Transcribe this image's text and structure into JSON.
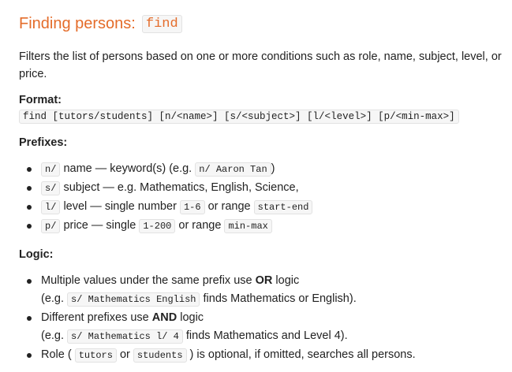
{
  "heading": {
    "text": "Finding persons:",
    "command": "find"
  },
  "description": "Filters the list of persons based on one or more conditions such as role, name, subject, level, or price.",
  "format": {
    "label": "Format:",
    "code": "find [tutors/students] [n/<name>] [s/<subject>] [l/<level>] [p/<min-max>]"
  },
  "prefixes": {
    "label": "Prefixes:",
    "items": [
      {
        "prefix": "n/",
        "text": "name — keyword(s) (e.g.",
        "code1": "n/ Aaron Tan",
        "tail": ")"
      },
      {
        "prefix": "s/",
        "text": "subject — e.g. Mathematics, English, Science,"
      },
      {
        "prefix": "l/",
        "text": "level — single number",
        "code1": "1-6",
        "mid": "or range",
        "code2": "start-end"
      },
      {
        "prefix": "p/",
        "text": "price — single",
        "code1": "1-200",
        "mid": "or range",
        "code2": "min-max"
      }
    ]
  },
  "logic": {
    "label": "Logic:",
    "items": [
      {
        "pre": "Multiple values under the same prefix use",
        "bold": "OR",
        "post": "logic",
        "ex_pre": "(e.g.",
        "ex_code": "s/ Mathematics English",
        "ex_post": "finds Mathematics or English)."
      },
      {
        "pre": "Different prefixes use",
        "bold": "AND",
        "post": "logic",
        "ex_pre": "(e.g.",
        "ex_code": "s/ Mathematics l/ 4",
        "ex_post": "finds Mathematics and Level 4)."
      },
      {
        "pre": "Role (",
        "code1": "tutors",
        "mid": "or",
        "code2": "students",
        "post": ") is optional, if omitted, searches all persons."
      }
    ]
  }
}
